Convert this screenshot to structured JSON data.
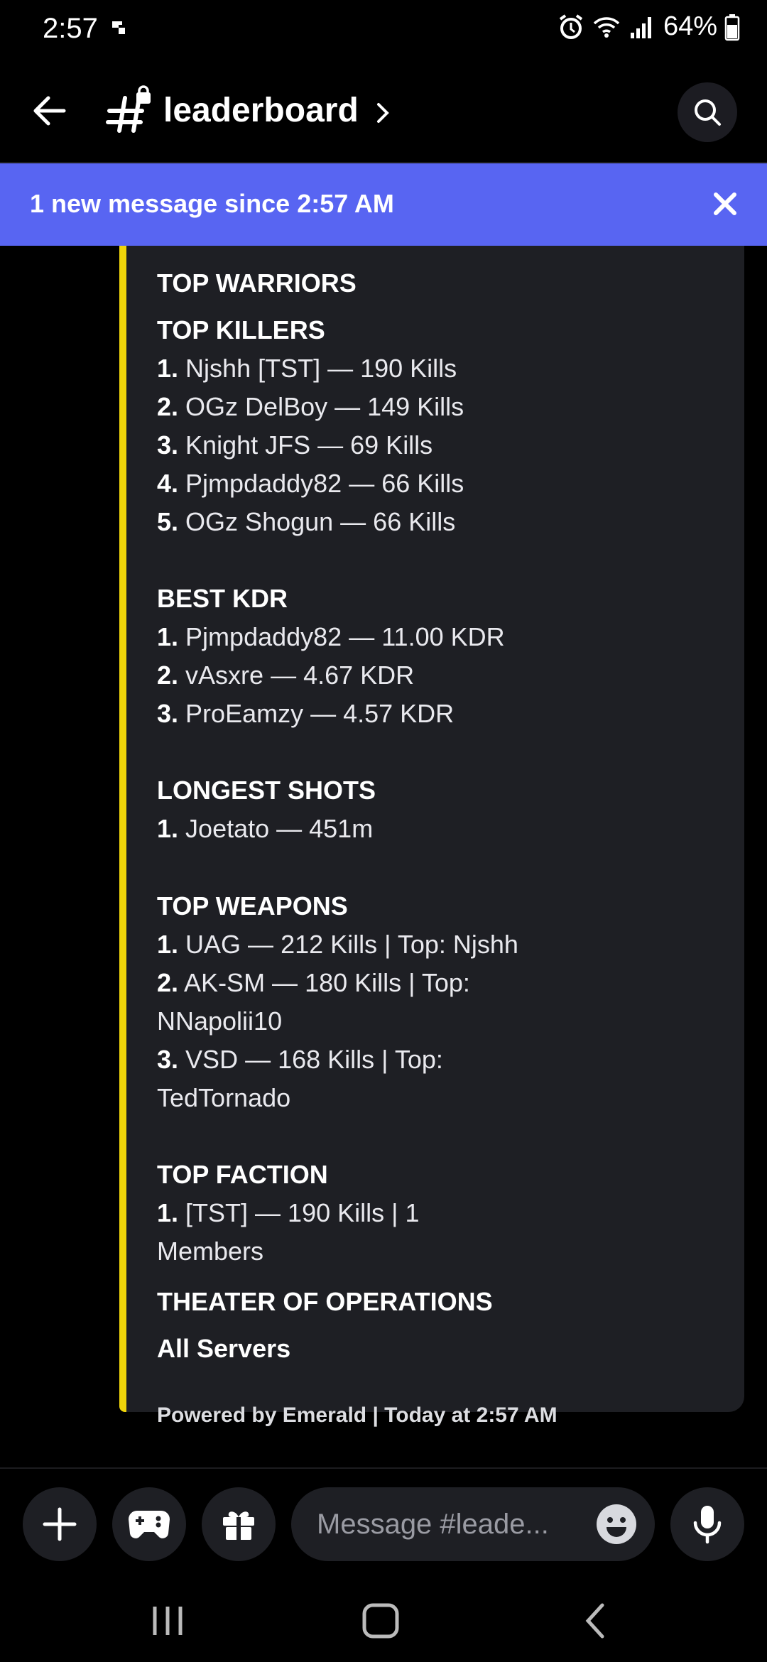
{
  "status_bar": {
    "time": "2:57",
    "battery": "64%"
  },
  "header": {
    "channel_name": "leaderboard"
  },
  "banner": {
    "text": "1 new message since 2:57 AM"
  },
  "embed": {
    "accent_color": "#f0d50a",
    "partial_title": "TOP WARRIORS",
    "top_killers": {
      "title": "TOP KILLERS",
      "items": [
        {
          "rank": "1.",
          "text": "Njshh [TST] — 190 Kills"
        },
        {
          "rank": "2.",
          "text": "OGz DelBoy — 149 Kills"
        },
        {
          "rank": "3.",
          "text": "Knight JFS — 69 Kills"
        },
        {
          "rank": "4.",
          "text": "Pjmpdaddy82 — 66 Kills"
        },
        {
          "rank": "5.",
          "text": "OGz Shogun — 66 Kills"
        }
      ]
    },
    "best_kdr": {
      "title": "BEST KDR",
      "items": [
        {
          "rank": "1.",
          "text": "Pjmpdaddy82 — 11.00 KDR"
        },
        {
          "rank": "2.",
          "text": "vAsxre — 4.67 KDR"
        },
        {
          "rank": "3.",
          "text": "ProEamzy — 4.57 KDR"
        }
      ]
    },
    "longest_shots": {
      "title": "LONGEST SHOTS",
      "items": [
        {
          "rank": "1.",
          "text": "Joetato — 451m"
        }
      ]
    },
    "top_weapons": {
      "title": "TOP WEAPONS",
      "items": [
        {
          "rank": "1.",
          "text": "UAG — 212 Kills | Top: Njshh"
        },
        {
          "rank": "2.",
          "text": "AK-SM — 180 Kills | Top:",
          "cont": "NNapolii10"
        },
        {
          "rank": "3.",
          "text": "VSD — 168 Kills | Top:",
          "cont": "TedTornado"
        }
      ]
    },
    "top_faction": {
      "title": "TOP FACTION",
      "items": [
        {
          "rank": "1.",
          "text": "[TST] — 190 Kills | 1",
          "cont": "Members"
        }
      ]
    },
    "theater": {
      "title": "THEATER OF OPERATIONS",
      "value": "All Servers"
    },
    "footer": "Powered by Emerald | Today at 2:57 AM"
  },
  "input": {
    "placeholder": "Message #leade..."
  },
  "icons": [
    "plus-icon",
    "gamepad-icon",
    "gift-icon",
    "emoji-icon",
    "microphone-icon",
    "search-icon",
    "back-arrow-icon",
    "locked-channel-hash-icon",
    "close-icon"
  ]
}
